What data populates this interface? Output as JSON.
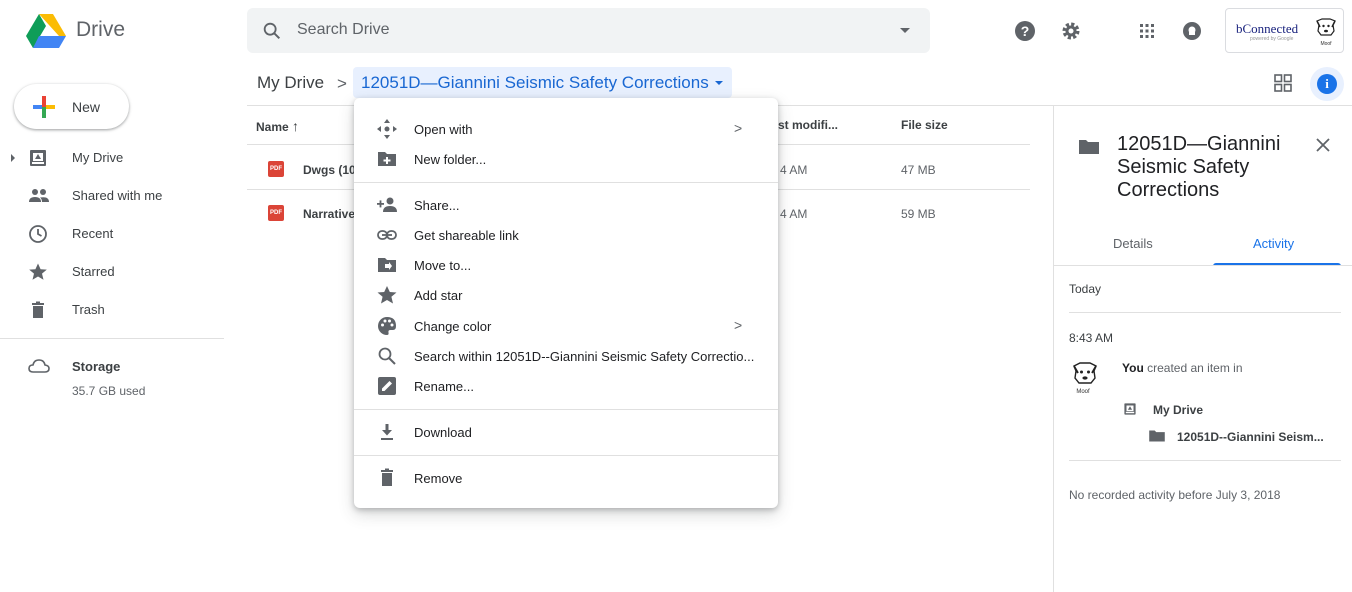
{
  "app": {
    "name": "Drive"
  },
  "search": {
    "placeholder": "Search Drive"
  },
  "header": {
    "brand_text": "bConnected",
    "brand_sub": "powered by Google",
    "avatar_caption": "Moof"
  },
  "new_button": {
    "label": "New"
  },
  "nav": {
    "items": [
      {
        "label": "My Drive"
      },
      {
        "label": "Shared with me"
      },
      {
        "label": "Recent"
      },
      {
        "label": "Starred"
      },
      {
        "label": "Trash"
      }
    ],
    "storage": {
      "label": "Storage",
      "used": "35.7 GB used"
    }
  },
  "breadcrumb": {
    "root": "My Drive",
    "separator": ">",
    "current": "12051D—Giannini Seismic Safety Corrections"
  },
  "file_list": {
    "columns": {
      "name": "Name",
      "modified": "st modifi...",
      "size": "File size"
    },
    "rows": [
      {
        "icon": "PDF",
        "name": "Dwgs (10",
        "modified": "4 AM",
        "size": "47 MB"
      },
      {
        "icon": "PDF",
        "name": "Narrative",
        "modified": "4 AM",
        "size": "59 MB"
      }
    ]
  },
  "context_menu": {
    "open_with": "Open with",
    "new_folder": "New folder...",
    "share": "Share...",
    "get_link": "Get shareable link",
    "move_to": "Move to...",
    "add_star": "Add star",
    "change_color": "Change color",
    "search_within": "Search within 12051D--Giannini Seismic Safety Correctio...",
    "rename": "Rename...",
    "download": "Download",
    "remove": "Remove",
    "submenu_glyph": ">"
  },
  "details_pane": {
    "title": "12051D—Giannini Seismic Safety Corrections",
    "tabs": {
      "details": "Details",
      "activity": "Activity"
    },
    "today_label": "Today",
    "time": "8:43 AM",
    "activity_actor": "You",
    "activity_text": " created an item in",
    "avatar_caption": "Moof",
    "location_root": "My Drive",
    "location_folder": "12051D--Giannini Seism...",
    "no_activity": "No recorded activity before July 3, 2018"
  },
  "colors": {
    "accent": "#1a73e8",
    "selection": "#e8f0fe",
    "pdf_red": "#db4437"
  }
}
